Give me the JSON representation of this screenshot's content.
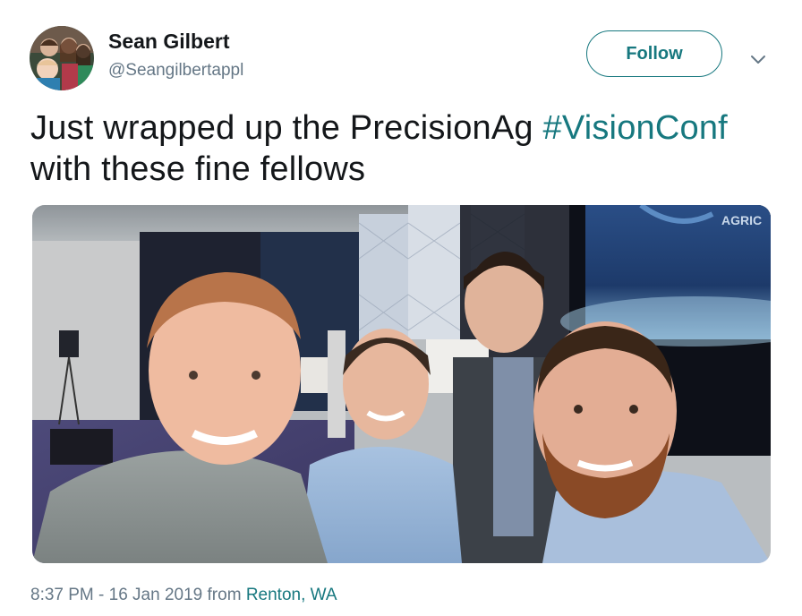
{
  "tweet": {
    "user": {
      "name": "Sean Gilbert",
      "handle": "@Seangilbertappl",
      "avatar_icon": "family-photo-avatar"
    },
    "follow_label": "Follow",
    "menu_icon": "chevron-down-icon",
    "text_part1": "Just wrapped up the PrecisionAg ",
    "hashtag": "#VisionConf",
    "text_part2": "with these fine fellows",
    "photo": {
      "description_icon": "group-selfie-photo",
      "screen_text": "AGRIC"
    },
    "meta": {
      "time": "8:37 PM - 16 Jan 2019",
      "from_word": " from ",
      "location": "Renton, WA"
    }
  },
  "colors": {
    "accent": "#17787f",
    "text": "#14171a",
    "secondary_text": "#657786"
  }
}
